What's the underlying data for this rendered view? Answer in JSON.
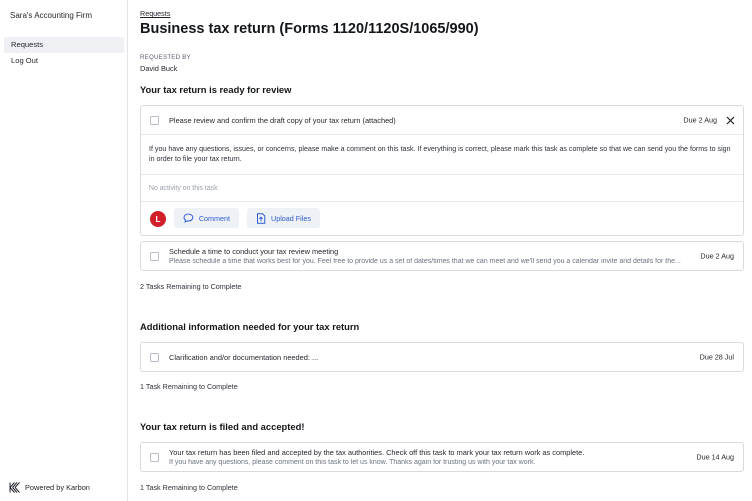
{
  "sidebar": {
    "firm_name": "Sara's Accounting Firm",
    "nav": [
      {
        "label": "Requests",
        "active": true
      },
      {
        "label": "Log Out",
        "active": false
      }
    ],
    "powered_by": "Powered by Karbon"
  },
  "main": {
    "breadcrumb": "Requests",
    "title": "Business tax return (Forms 1120/1120S/1065/990)",
    "requested_by_label": "REQUESTED BY",
    "requested_by_name": "David Buck",
    "sections": [
      {
        "title": "Your tax return is ready for review",
        "tasks": [
          {
            "title": "Please review and confirm the draft copy of your tax return (attached)",
            "due": "Due 2 Aug",
            "description": "If you have any questions, issues, or concerns, please make a comment on this task. If everything is correct, please mark this task as complete so that we can send you the forms to sign in order to file your tax return.",
            "activity": "No activity on this task",
            "avatar_initial": "L",
            "comment_label": "Comment",
            "upload_label": "Upload Files"
          },
          {
            "title": "Schedule a time to conduct your tax review meeting",
            "subtitle": "Please schedule a time that works best for you. Feel free to provide us a set of dates/times that we can meet and we'll send you a calendar invite and details for the...",
            "due": "Due 2 Aug"
          }
        ],
        "remaining": "2 Tasks Remaining to Complete"
      },
      {
        "title": "Additional information needed for your tax return",
        "tasks": [
          {
            "title": "Clarification and/or documentation needed: ...",
            "due": "Due 28 Jul"
          }
        ],
        "remaining": "1 Task Remaining to Complete"
      },
      {
        "title": "Your tax return is filed and accepted!",
        "tasks": [
          {
            "title": "Your tax return has been filed and accepted by the tax authorities. Check off this task to mark your tax return work as complete.",
            "subtitle": "If you have any questions, please comment on this task to let us know. Thanks again for trusting us with your tax work.",
            "due": "Due 14 Aug"
          }
        ],
        "remaining": "1 Task Remaining to Complete"
      }
    ]
  },
  "icons": {
    "close": "close-icon",
    "comment": "comment-icon",
    "upload": "upload-icon",
    "karbon_logo": "karbon-logo-icon"
  },
  "colors": {
    "accent": "#2d5bd0",
    "avatar": "#d0202a",
    "active_nav": "#eef0f3",
    "border": "#d7dadf"
  }
}
